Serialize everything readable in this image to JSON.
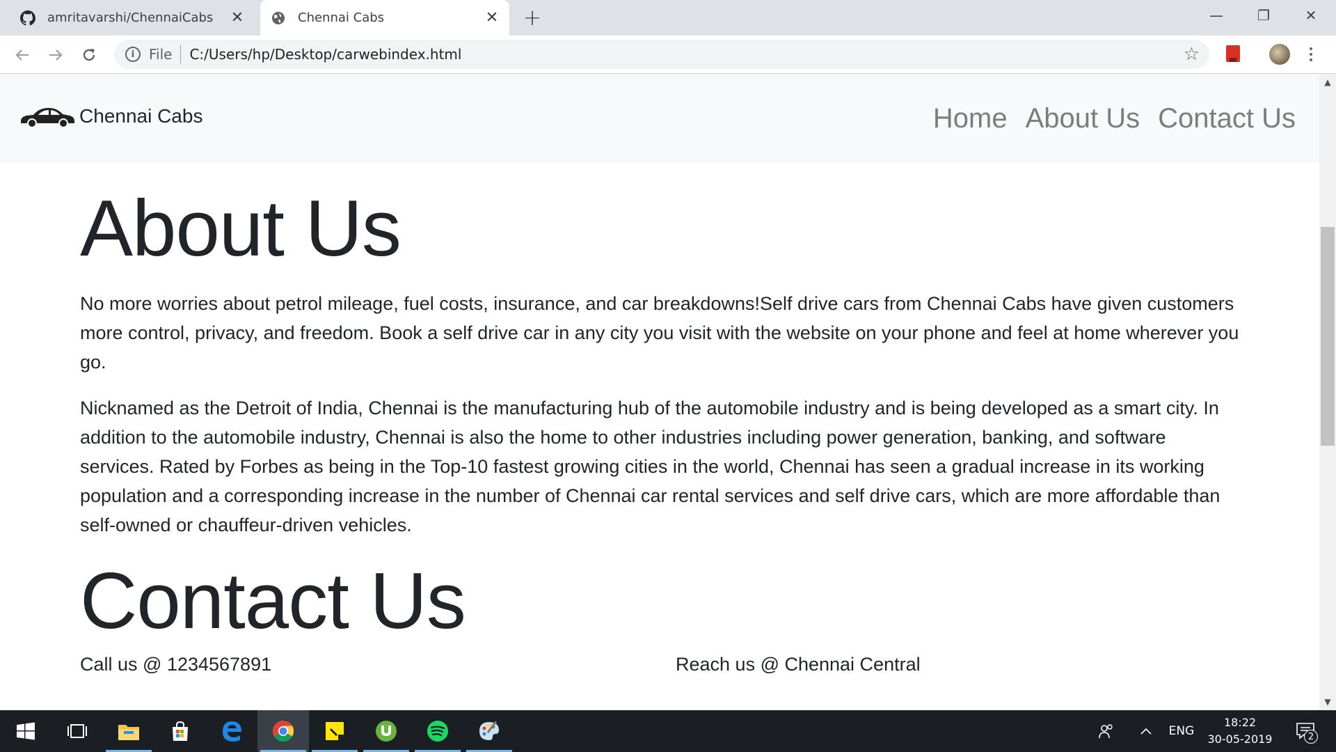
{
  "browser": {
    "tabs": [
      {
        "title": "amritavarshi/ChennaiCabs",
        "icon": "github-icon",
        "active": false
      },
      {
        "title": "Chennai Cabs",
        "icon": "globe-icon",
        "active": true
      }
    ],
    "address": {
      "scheme_label": "File",
      "url": "C:/Users/hp/Desktop/carwebindex.html"
    }
  },
  "site": {
    "brand": "Chennai Cabs",
    "nav": [
      "Home",
      "About Us",
      "Contact Us"
    ],
    "about": {
      "heading": "About Us",
      "paragraphs": [
        "No more worries about petrol mileage, fuel costs, insurance, and car breakdowns!Self drive cars from Chennai Cabs have given customers more control, privacy, and freedom. Book a self drive car in any city you visit with the website on your phone and feel at home wherever you go.",
        "Nicknamed as the Detroit of India, Chennai is the manufacturing hub of the automobile industry and is being developed as a smart city. In addition to the automobile industry, Chennai is also the home to other industries including power generation, banking, and software services. Rated by Forbes as being in the Top-10 fastest growing cities in the world, Chennai has seen a gradual increase in its working population and a corresponding increase in the number of Chennai car rental services and self drive cars, which are more affordable than self-owned or chauffeur-driven vehicles."
      ]
    },
    "contact": {
      "heading": "Contact Us",
      "phone": "Call us @ 1234567891",
      "location": "Reach us @ Chennai Central"
    }
  },
  "taskbar": {
    "apps": [
      "start-icon",
      "task-view-icon",
      "file-explorer-icon",
      "store-icon",
      "edge-icon",
      "chrome-icon",
      "sticky-notes-icon",
      "utorrent-icon",
      "spotify-icon",
      "paint-icon"
    ],
    "language": "ENG",
    "time": "18:22",
    "date": "30-05-2019",
    "notification_count": "2"
  },
  "colors": {
    "tabstrip": "#dee1e6",
    "navbar": "#f8f9fa",
    "text": "#212529",
    "nav_link": "rgba(0,0,0,0.5)",
    "taskbar": "#1b1f24"
  }
}
